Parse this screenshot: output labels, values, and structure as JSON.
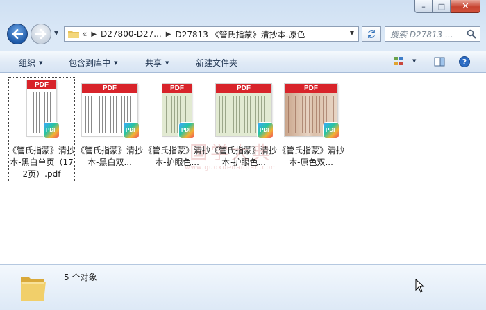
{
  "window": {
    "caption_buttons": {
      "minimize": "–",
      "maximize": "□",
      "close": "✕"
    }
  },
  "nav": {
    "back_glyph": "←",
    "forward_glyph": "→",
    "breadcrumb": {
      "overflow": "«",
      "parent": "D27800-D27...",
      "current": "D27813 《管氏指蒙》清抄本.原色"
    },
    "search_placeholder": "搜索 D27813 ..."
  },
  "commands": {
    "organize": "组织",
    "include_in_library": "包含到库中",
    "share": "共享",
    "new_folder": "新建文件夹"
  },
  "files": [
    {
      "label": "《管氏指蒙》清抄本-黑白单页（172页）.pdf",
      "thumb_style": "bw-single",
      "selected": true
    },
    {
      "label": "《管氏指蒙》清抄本-黑白双...",
      "thumb_style": "bw-double",
      "selected": false
    },
    {
      "label": "《管氏指蒙》清抄本-护眼色...",
      "thumb_style": "green-single",
      "selected": false
    },
    {
      "label": "《管氏指蒙》清抄本-护眼色...",
      "thumb_style": "green-double",
      "selected": false
    },
    {
      "label": "《管氏指蒙》清抄本-原色双...",
      "thumb_style": "original-double",
      "selected": false
    }
  ],
  "thumb_badge": {
    "band": "PDF",
    "badge": "PDF"
  },
  "watermark": {
    "main": "国学大典",
    "sub": "www.guoxuedaidian.com"
  },
  "status": {
    "count": "5 个对象"
  },
  "colors": {
    "pdf_red": "#d8232a",
    "eye_care_green": "#e2ead2",
    "original_paper": "#d9b9a0"
  }
}
